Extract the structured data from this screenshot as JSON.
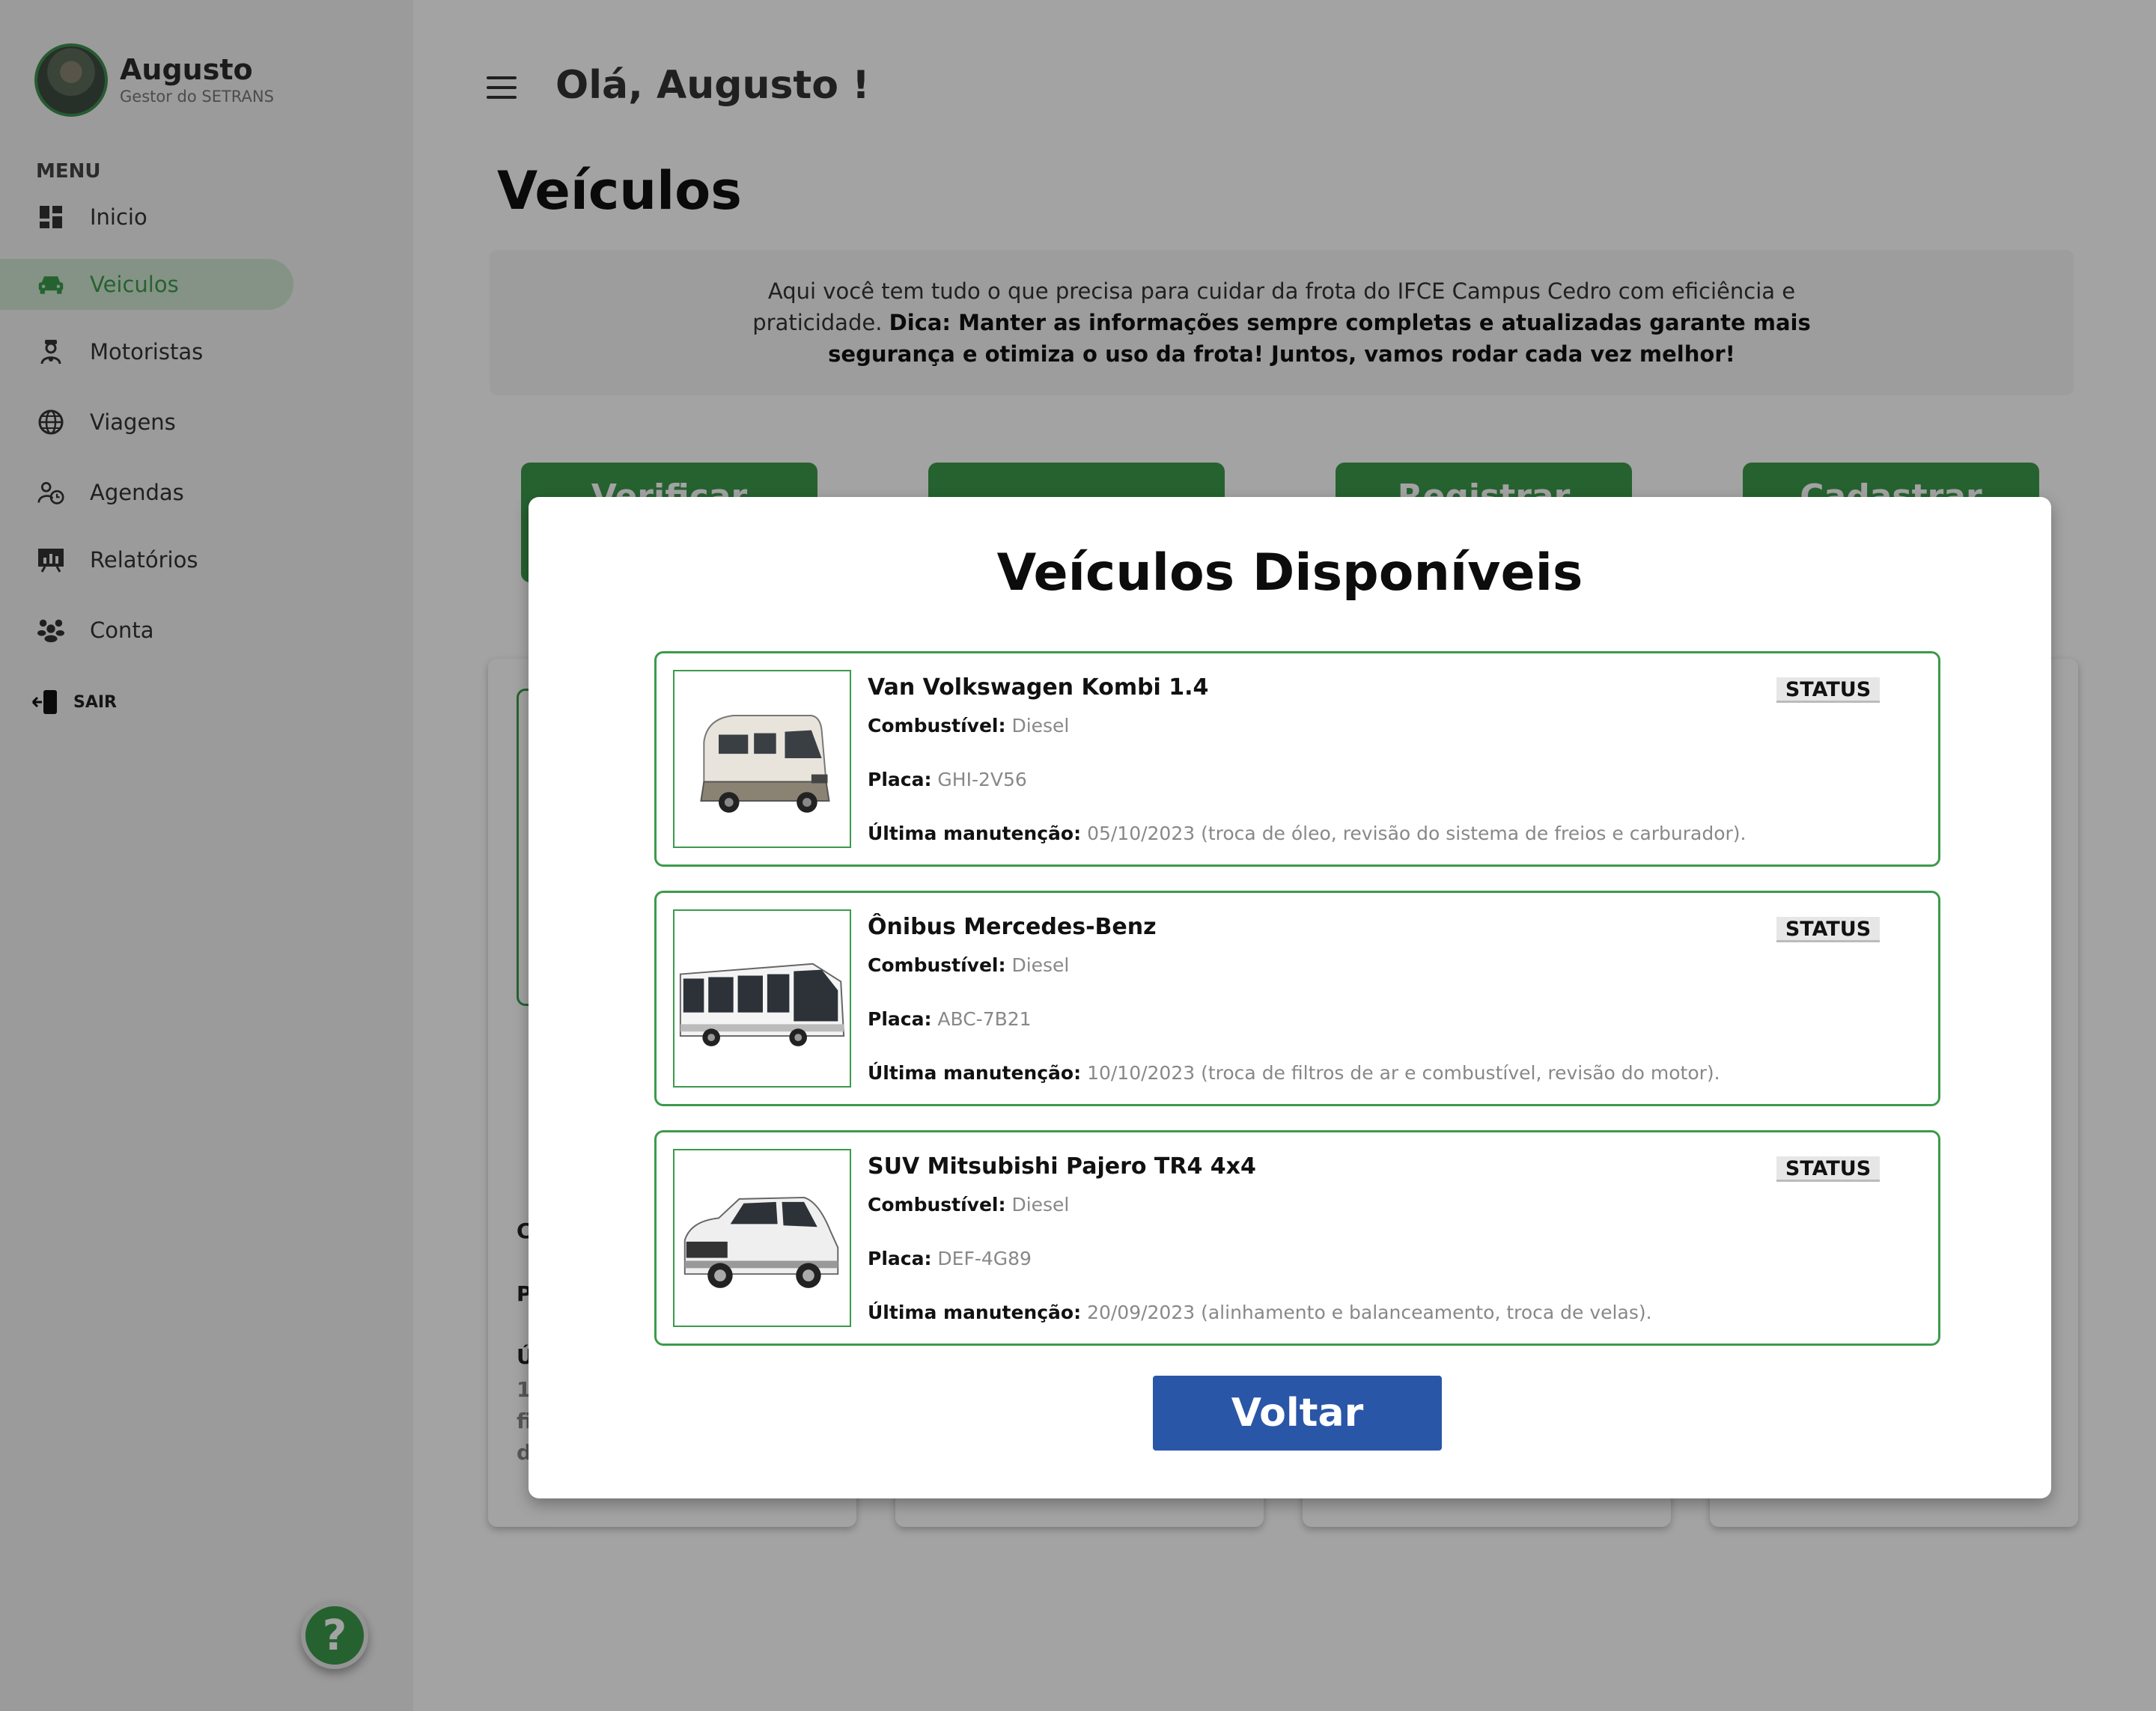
{
  "user": {
    "name": "Augusto",
    "role": "Gestor do SETRANS"
  },
  "sidebar": {
    "menu_heading": "MENU",
    "items": [
      {
        "label": "Inicio",
        "icon": "dashboard-icon"
      },
      {
        "label": "Veiculos",
        "icon": "car-icon",
        "active": true
      },
      {
        "label": "Motoristas",
        "icon": "driver-icon"
      },
      {
        "label": "Viagens",
        "icon": "globe-icon"
      },
      {
        "label": "Agendas",
        "icon": "schedule-icon"
      },
      {
        "label": "Relatórios",
        "icon": "report-icon"
      },
      {
        "label": "Conta",
        "icon": "account-icon"
      }
    ],
    "logout_label": "SAIR",
    "help_label": "?"
  },
  "header": {
    "greeting": "Olá, Augusto !"
  },
  "page": {
    "title": "Veículos",
    "info_text": "Aqui você tem tudo o que precisa para cuidar da frota do IFCE Campus Cedro com eficiência e praticidade. ",
    "info_tip": "Dica: Manter as informações sempre completas e atualizadas garante mais segurança e otimiza o uso da frota! Juntos, vamos rodar cada vez melhor!",
    "actions": [
      "Verificar",
      "",
      "Registrar",
      "Cadastrar"
    ],
    "card_fragments": [
      "C",
      "P",
      "Ú",
      "1",
      "fi",
      "d"
    ]
  },
  "modal": {
    "title": "Veículos Disponíveis",
    "labels": {
      "fuel": "Combustível:",
      "plate": "Placa:",
      "maintenance": "Última manutenção:"
    },
    "vehicles": [
      {
        "name": "Van Volkswagen Kombi 1.4",
        "fuel": "Diesel",
        "plate": "GHI-2V56",
        "maintenance": "05/10/2023 (troca de óleo, revisão do sistema de freios e carburador).",
        "status": "STATUS"
      },
      {
        "name": "Ônibus Mercedes-Benz",
        "fuel": "Diesel",
        "plate": "ABC-7B21",
        "maintenance": "10/10/2023 (troca de filtros de ar e combustível, revisão do motor).",
        "status": "STATUS"
      },
      {
        "name": "SUV Mitsubishi Pajero TR4 4x4",
        "fuel": "Diesel",
        "plate": "DEF-4G89",
        "maintenance": "20/09/2023 (alinhamento e balanceamento, troca de velas).",
        "status": "STATUS"
      }
    ],
    "back_button": "Voltar"
  },
  "colors": {
    "primary_green": "#3c9a4c",
    "active_nav_bg": "#cfe6d2",
    "button_blue": "#2a56a8"
  }
}
